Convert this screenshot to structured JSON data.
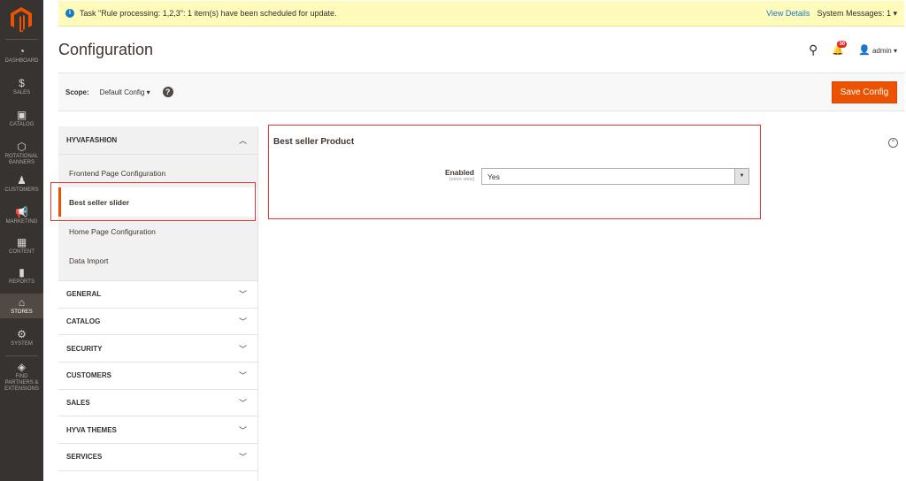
{
  "sidebar": {
    "items": [
      {
        "label": "DASHBOARD",
        "icon": "dashboard-icon",
        "glyph": "◔"
      },
      {
        "label": "SALES",
        "icon": "dollar-icon",
        "glyph": "$"
      },
      {
        "label": "CATALOG",
        "icon": "box-icon",
        "glyph": "▣"
      },
      {
        "label": "ROTATIONAL BANNERS",
        "icon": "hexagon-icon",
        "glyph": "⬡"
      },
      {
        "label": "CUSTOMERS",
        "icon": "person-icon",
        "glyph": "♟"
      },
      {
        "label": "MARKETING",
        "icon": "megaphone-icon",
        "glyph": "📢"
      },
      {
        "label": "CONTENT",
        "icon": "layout-icon",
        "glyph": "▦"
      },
      {
        "label": "REPORTS",
        "icon": "bar-chart-icon",
        "glyph": "▮"
      },
      {
        "label": "STORES",
        "icon": "store-icon",
        "glyph": "⌂"
      },
      {
        "label": "SYSTEM",
        "icon": "gear-icon",
        "glyph": "⚙"
      },
      {
        "label": "FIND PARTNERS & EXTENSIONS",
        "icon": "blocks-icon",
        "glyph": "◈"
      }
    ],
    "active": "STORES"
  },
  "message": {
    "text": "Task \"Rule processing: 1,2,3\": 1 item(s) have been scheduled for update.",
    "view_details": "View Details",
    "system_messages": "System Messages: 1"
  },
  "header": {
    "title": "Configuration",
    "notifications": "30",
    "user": "admin"
  },
  "scope": {
    "label": "Scope:",
    "value": "Default Config",
    "save": "Save Config"
  },
  "tabs": {
    "open_group": "HYVAFASHION",
    "items": [
      "Frontend Page Configuration",
      "Best seller slider",
      "Home Page Configuration",
      "Data Import"
    ],
    "active": "Best seller slider",
    "groups": [
      "GENERAL",
      "CATALOG",
      "SECURITY",
      "CUSTOMERS",
      "SALES",
      "HYVA THEMES",
      "SERVICES"
    ]
  },
  "section": {
    "title": "Best seller Product",
    "field_label": "Enabled",
    "field_scope": "[store view]",
    "field_value": "Yes"
  },
  "colors": {
    "accent": "#eb5202",
    "sidebar": "#373330",
    "highlight": "#e53535"
  }
}
